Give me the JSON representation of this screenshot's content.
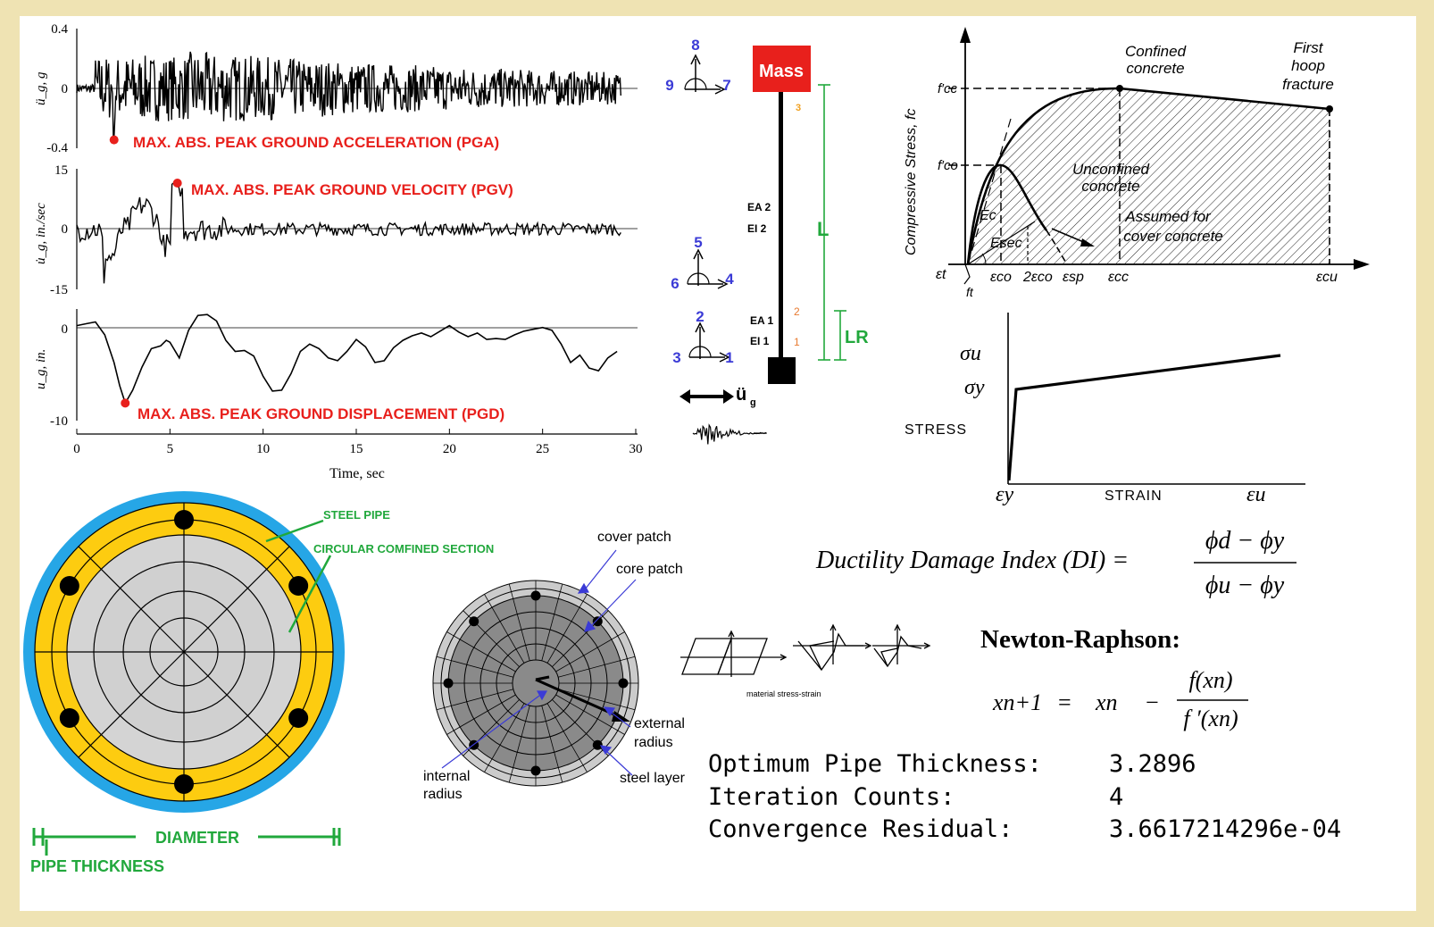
{
  "chart_data": [
    {
      "type": "line",
      "ylabel": "ü_g, g",
      "ylim": [
        -0.4,
        0.4
      ],
      "yticks": [
        "0.4",
        "0",
        "-0.4"
      ],
      "peak": {
        "x": 2.0,
        "y": -0.32
      },
      "annotation": "MAX. ABS. PEAK GROUND ACCELERATION (PGA)"
    },
    {
      "type": "line",
      "ylabel": "u̇_g, in./sec",
      "ylim": [
        -15,
        15
      ],
      "yticks": [
        "15",
        "0",
        "-15"
      ],
      "peak": {
        "x": 5.4,
        "y": 11
      },
      "annotation": "MAX. ABS. PEAK GROUND VELOCITY (PGV)"
    },
    {
      "type": "line",
      "ylabel": "u_g, in.",
      "ylim": [
        -10,
        2
      ],
      "yticks": [
        "0",
        "-10"
      ],
      "peak": {
        "x": 2.6,
        "y": -8.4
      },
      "annotation": "MAX. ABS. PEAK GROUND DISPLACEMENT (PGD)",
      "x": [
        0,
        0.5,
        1,
        1.5,
        2,
        2.3,
        2.6,
        3,
        3.5,
        4,
        4.5,
        4.8,
        5,
        5.5,
        6,
        6.5,
        7,
        7.5,
        8,
        8.5,
        9,
        9.5,
        10,
        10.5,
        11,
        11.5,
        12,
        12.5,
        13,
        13.5,
        14,
        14.5,
        15,
        15.5,
        16,
        16.5,
        17,
        17.5,
        18,
        18.5,
        19,
        19.5,
        20,
        20.5,
        21,
        21.5,
        22,
        22.5,
        23,
        23.5,
        24,
        24.5,
        25,
        25.5,
        26,
        26.5,
        27,
        27.5,
        28,
        28.5,
        29
      ],
      "y": [
        0,
        0.2,
        0.4,
        -1,
        -4,
        -6.5,
        -8.4,
        -7,
        -4.5,
        -2.5,
        -2.2,
        -1.6,
        -1.8,
        -3.5,
        -0.5,
        1.1,
        1.2,
        0.5,
        -1.6,
        -2.8,
        -2.7,
        -3.3,
        -5.5,
        -7.1,
        -7,
        -5.2,
        -2.8,
        -2,
        -2.5,
        -3.5,
        -3.8,
        -2.8,
        -1.5,
        -2.3,
        -4,
        -3.8,
        -2.4,
        -1.6,
        -1.1,
        -0.8,
        -1.2,
        -0.6,
        0,
        -0.7,
        -1.2,
        -0.8,
        -1.5,
        -1.4,
        -1.5,
        -1,
        -0.6,
        -0.4,
        -0.2,
        -0.5,
        -2,
        -4,
        -3.2,
        -4.6,
        -4.9,
        -3.5,
        -2.8
      ]
    }
  ],
  "time_axis": {
    "label": "Time, sec",
    "ticks": [
      "0",
      "5",
      "10",
      "15",
      "20",
      "25",
      "30"
    ]
  },
  "sdof": {
    "mass": "Mass",
    "L": "L",
    "LR": "LR",
    "ea2": "EA 2",
    "ei2": "EI 2",
    "ea1": "EA 1",
    "ei1": "EI 1",
    "n3": "3",
    "n2": "2",
    "n1": "1",
    "dof_top": [
      "8",
      "9",
      "7"
    ],
    "dof_mid": [
      "5",
      "6",
      "4"
    ],
    "dof_bot": [
      "2",
      "3",
      "1"
    ],
    "ground": "ü",
    "ground_sub": "g"
  },
  "concrete": {
    "ylabel": "Compressive Stress, fc",
    "fcc": "f′cc",
    "fco": "f′co",
    "confined": [
      "Confined",
      "concrete"
    ],
    "hoop": [
      "First",
      "hoop",
      "fracture"
    ],
    "unconfined": [
      "Unconfined",
      "concrete"
    ],
    "cover": [
      "Assumed for",
      "cover concrete"
    ],
    "ec": "Ec",
    "esec": "Esec",
    "xticks": [
      "εt",
      "εco",
      "2εco",
      "εsp",
      "εcc",
      "εcu"
    ],
    "ft": "ft"
  },
  "steel": {
    "su": "σu",
    "sy": "σy",
    "stress": "STRESS",
    "strain": "STRAIN",
    "ey": "εy",
    "eu": "εu"
  },
  "pipe": {
    "steel_pipe": "STEEL PIPE",
    "confined": "CIRCULAR COMFINED SECTION",
    "diameter": "DIAMETER",
    "thickness": "PIPE THICKNESS"
  },
  "fiber": {
    "cover": "cover patch",
    "core": "core patch",
    "ext1": "external",
    "ext2": "radius",
    "int1": "internal",
    "int2": "radius",
    "steel": "steel layer"
  },
  "material_label": "material stress-strain",
  "ductility": {
    "text": "Ductility Damage Index (DI) =",
    "num": "ϕd − ϕy",
    "den": "ϕu − ϕy"
  },
  "newton": {
    "title": "Newton-Raphson:",
    "lhs": "xn+1",
    "eq": "=",
    "xn": "xn",
    "minus": "−",
    "num": "f(xn)",
    "den": "f ′(xn)"
  },
  "results": [
    {
      "label": "Optimum Pipe Thickness:",
      "value": "3.2896"
    },
    {
      "label": "Iteration Counts:",
      "value": "4"
    },
    {
      "label": "Convergence Residual:",
      "value": "3.6617214296e-04"
    }
  ]
}
